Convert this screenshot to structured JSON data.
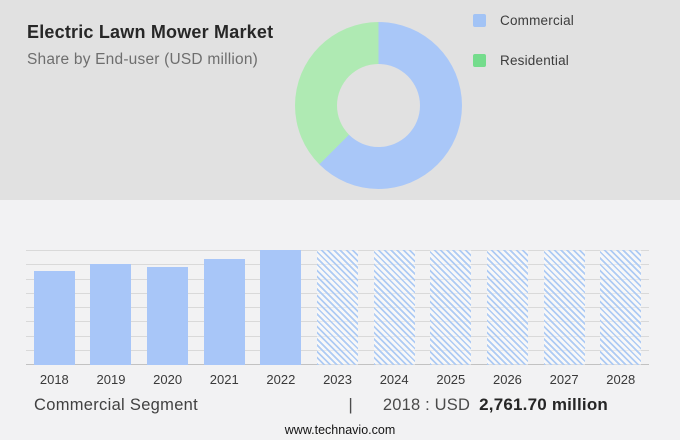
{
  "header": {
    "title": "Electric Lawn Mower Market",
    "subtitle": "Share by End-user (USD million)"
  },
  "chart_data": [
    {
      "type": "pie",
      "subtype": "donut",
      "title": "Share by End-user (USD million)",
      "segments": [
        {
          "label": "Commercial",
          "pct": 62.5,
          "color": "#a9c7f8",
          "legend_color": "#a2c3f5"
        },
        {
          "label": "Residential",
          "pct": 37.5,
          "color": "#afeab3",
          "legend_color": "#74dc8c"
        }
      ],
      "start": "12 o'clock, clockwise, Commercial first",
      "legend_position": "right",
      "data_labels": "none"
    },
    {
      "type": "bar",
      "title": "Commercial Segment",
      "categories": [
        "2018",
        "2019",
        "2020",
        "2021",
        "2022",
        "2023",
        "2024",
        "2025",
        "2026",
        "2027",
        "2028"
      ],
      "series": [
        {
          "name": "Commercial",
          "values_usd_million": [
            2761.7,
            2970,
            2860,
            3090,
            3370,
            null,
            null,
            null,
            null,
            null,
            null
          ],
          "bar_heights_pct": [
            82,
            88,
            85,
            92,
            100,
            100,
            100,
            100,
            100,
            100,
            100
          ],
          "hatched": [
            false,
            false,
            false,
            false,
            false,
            true,
            true,
            true,
            true,
            true,
            true
          ]
        }
      ],
      "labeled_point": {
        "year": "2018",
        "value_usd_million": "2,761.70"
      },
      "note": "Only the 2018 value is labeled on screen; 2019-2022 values estimated from bar heights vs gridlines; 2023-2028 are hatched forecast placeholders drawn at full height",
      "gridline_count": 9,
      "grid": true,
      "bar_color": "#a8c6f8",
      "hatch_color": "#aecbf4",
      "yaxis_labels": "none"
    }
  ],
  "caption": {
    "left": "Commercial Segment",
    "separator": "|",
    "prefix": "2018 : USD",
    "value": "2,761.70 million"
  },
  "footer": {
    "url": "www.technavio.com"
  }
}
